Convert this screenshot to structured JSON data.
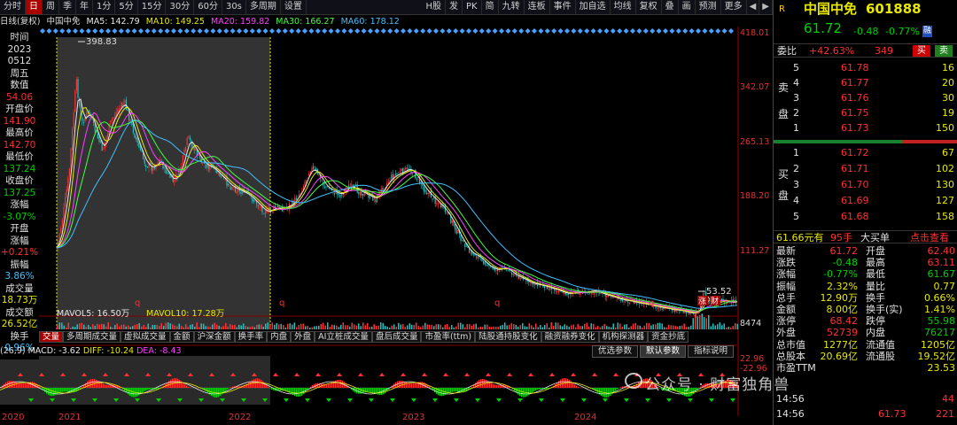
{
  "toolbar": {
    "periods": [
      "分时",
      "日",
      "周",
      "季",
      "年",
      "1分",
      "5分",
      "15分",
      "30分",
      "60分",
      "30s",
      "多周期",
      "设置"
    ],
    "active": "日",
    "right_buttons": [
      "H股",
      "发",
      "PK",
      "简",
      "九转",
      "连板",
      "事件",
      "加自选",
      "均线",
      "复权",
      "叠",
      "画",
      "预测",
      "更多"
    ]
  },
  "ma_bar": {
    "title": "日线(复权)",
    "name": "中国中免",
    "ma5": "MA5: 142.79",
    "ma10": "MA10: 149.25",
    "ma20": "MA20: 159.82",
    "ma30": "MA30: 166.27",
    "ma60": "MA60: 178.12"
  },
  "left_info": {
    "time_label": "时间",
    "year": "2023",
    "date": "0512",
    "weekday": "周五",
    "count_label": "数值",
    "count": "54.06",
    "open_label": "开盘价",
    "open": "141.90",
    "high_label": "最高价",
    "high": "142.70",
    "low_label": "最低价",
    "low": "137.24",
    "close_label": "收盘价",
    "close": "137.25",
    "chg_label": "涨幅",
    "chg": "-3.07%",
    "gap_label1": "开盘",
    "gap_label2": "涨幅",
    "gap": "+0.21%",
    "amp_label": "振幅",
    "amp": "3.86%",
    "vol_label": "成交量",
    "vol": "18.73万",
    "amt_label": "成交额",
    "amt": "26.52亿",
    "turn_label": "换手",
    "turn": "0.96%"
  },
  "price_axis": [
    "418.01",
    "342.07",
    "265.13",
    "188.20",
    "111.27"
  ],
  "annotations": {
    "peak": "398.83",
    "low": "53.52",
    "vol_axis": "8474",
    "events": [
      "涨",
      "财"
    ]
  },
  "volume_bar": {
    "mavol5": "MAVOL5: 16.50万",
    "mavol10": "MAVOL10: 17.28万"
  },
  "indicator_tabs": [
    "交量",
    "多周期成交量",
    "虚拟成交量",
    "金额",
    "沪深金额",
    "换手率",
    "内盘",
    "外盘",
    "AI立桩成交量",
    "盘后成交量",
    "市盈率(ttm)",
    "陆股通持股变化",
    "融资融券变化",
    "机构探测器",
    "资金抄底"
  ],
  "macd_bar": {
    "params": "(26,9)",
    "macd": "MACD: -3.62",
    "diff": "DIFF: -10.24",
    "dea": "DEA: -8.43",
    "macd_axis": [
      "22.96",
      "-22.96"
    ]
  },
  "macd_buttons": [
    "优选参数",
    "默认参数",
    "指标说明"
  ],
  "year_labels": [
    "2020",
    "2021",
    "2022",
    "2023",
    "2024"
  ],
  "stock": {
    "name": "中国中免",
    "code": "601888",
    "price": "61.72",
    "change": "-0.48",
    "pct": "-0.77%",
    "tag": "融",
    "r_flag": "R"
  },
  "webi": {
    "label": "委比",
    "value": "+42.63%",
    "diff": "349",
    "buy": "买",
    "sell": "卖"
  },
  "asks": [
    {
      "lvl": "5",
      "price": "61.78",
      "vol": "16"
    },
    {
      "lvl": "4",
      "price": "61.77",
      "vol": "20"
    },
    {
      "lvl": "3",
      "price": "61.76",
      "vol": "30"
    },
    {
      "lvl": "2",
      "price": "61.75",
      "vol": "19"
    },
    {
      "lvl": "1",
      "price": "61.73",
      "vol": "150"
    }
  ],
  "ask_label": [
    "卖",
    "盘"
  ],
  "bids": [
    {
      "lvl": "1",
      "price": "61.72",
      "vol": "67"
    },
    {
      "lvl": "2",
      "price": "61.71",
      "vol": "102"
    },
    {
      "lvl": "3",
      "price": "61.70",
      "vol": "130"
    },
    {
      "lvl": "4",
      "price": "61.69",
      "vol": "127"
    },
    {
      "lvl": "5",
      "price": "61.68",
      "vol": "158"
    }
  ],
  "bid_label": [
    "买",
    "盘"
  ],
  "big_order": {
    "text1": "61.66元有",
    "text2": "95手",
    "text3": "大买单",
    "link": "点击查看"
  },
  "stats": [
    {
      "l1": "最新",
      "v1": "61.72",
      "c1": "red",
      "l2": "开盘",
      "v2": "62.40",
      "c2": "red"
    },
    {
      "l1": "涨跌",
      "v1": "-0.48",
      "c1": "green",
      "l2": "最高",
      "v2": "63.11",
      "c2": "red"
    },
    {
      "l1": "涨幅",
      "v1": "-0.77%",
      "c1": "green",
      "l2": "最低",
      "v2": "61.67",
      "c2": "green"
    },
    {
      "l1": "振幅",
      "v1": "2.32%",
      "c1": "yel",
      "l2": "量比",
      "v2": "0.77",
      "c2": "yel"
    },
    {
      "l1": "总手",
      "v1": "12.90万",
      "c1": "yel",
      "l2": "换手",
      "v2": "0.66%",
      "c2": "yel"
    },
    {
      "l1": "金额",
      "v1": "8.00亿",
      "c1": "yel",
      "l2": "换手(实)",
      "v2": "1.41%",
      "c2": "yel"
    },
    {
      "l1": "涨停",
      "v1": "68.42",
      "c1": "red",
      "l2": "跌停",
      "v2": "55.98",
      "c2": "green"
    },
    {
      "l1": "外盘",
      "v1": "52739",
      "c1": "red",
      "l2": "内盘",
      "v2": "76217",
      "c2": "green"
    },
    {
      "l1": "总市值",
      "v1": "1277亿",
      "c1": "yel",
      "l2": "流通值",
      "v2": "1205亿",
      "c2": "yel"
    },
    {
      "l1": "总股本",
      "v1": "20.69亿",
      "c1": "yel",
      "l2": "流通股",
      "v2": "19.52亿",
      "c2": "yel"
    },
    {
      "l1": "市盈TTM",
      "v1": "",
      "c1": "yel",
      "l2": "",
      "v2": "23.53",
      "c2": "yel"
    }
  ],
  "ticks": [
    {
      "time": "14:56",
      "price": "",
      "vol": "44"
    },
    {
      "time": "14:56",
      "price": "61.73",
      "vol": "221"
    }
  ],
  "watermark": "公众号 · 财富独角兽"
}
